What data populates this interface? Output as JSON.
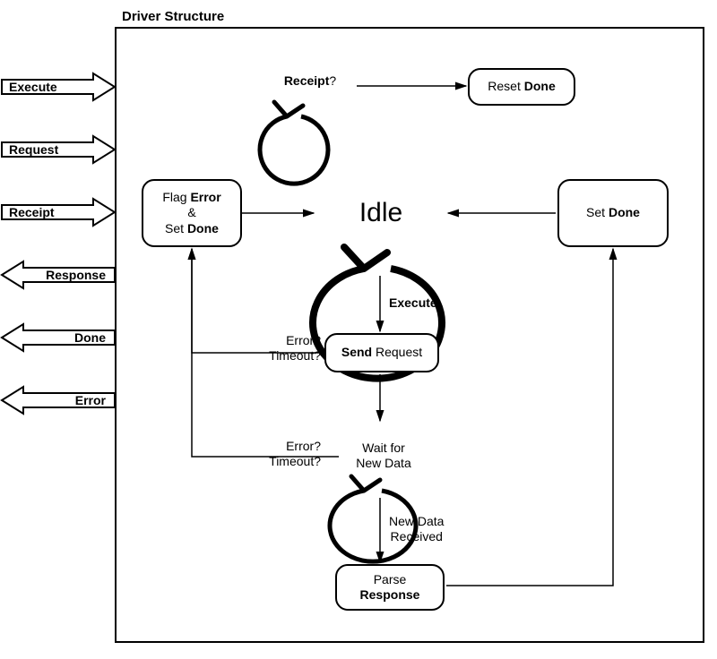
{
  "title": "Driver Structure",
  "signals": {
    "execute": "Execute",
    "request": "Request",
    "receipt": "Receipt",
    "response": "Response",
    "done": "Done",
    "error": "Error"
  },
  "nodes": {
    "receipt_q_prefix": "Receipt",
    "receipt_q_suffix": "?",
    "reset_done_prefix": "Reset ",
    "reset_done_bold": "Done",
    "flag_error_l1a": "Flag ",
    "flag_error_l1b": "Error",
    "flag_error_l2": "&",
    "flag_error_l3a": "Set ",
    "flag_error_l3b": "Done",
    "idle": "Idle",
    "set_done_a": "Set ",
    "set_done_b": "Done",
    "send_req_a": "Send",
    "send_req_b": " Request",
    "wait_l1": "Wait for",
    "wait_l2": "New Data",
    "parse_l1": "Parse",
    "parse_l2": "Response"
  },
  "edges": {
    "execute_label": "Execute",
    "err_timeout_l1": "Error?",
    "err_timeout_l2": "Timeout?",
    "new_data_l1": "New Data",
    "new_data_l2": "Received"
  }
}
